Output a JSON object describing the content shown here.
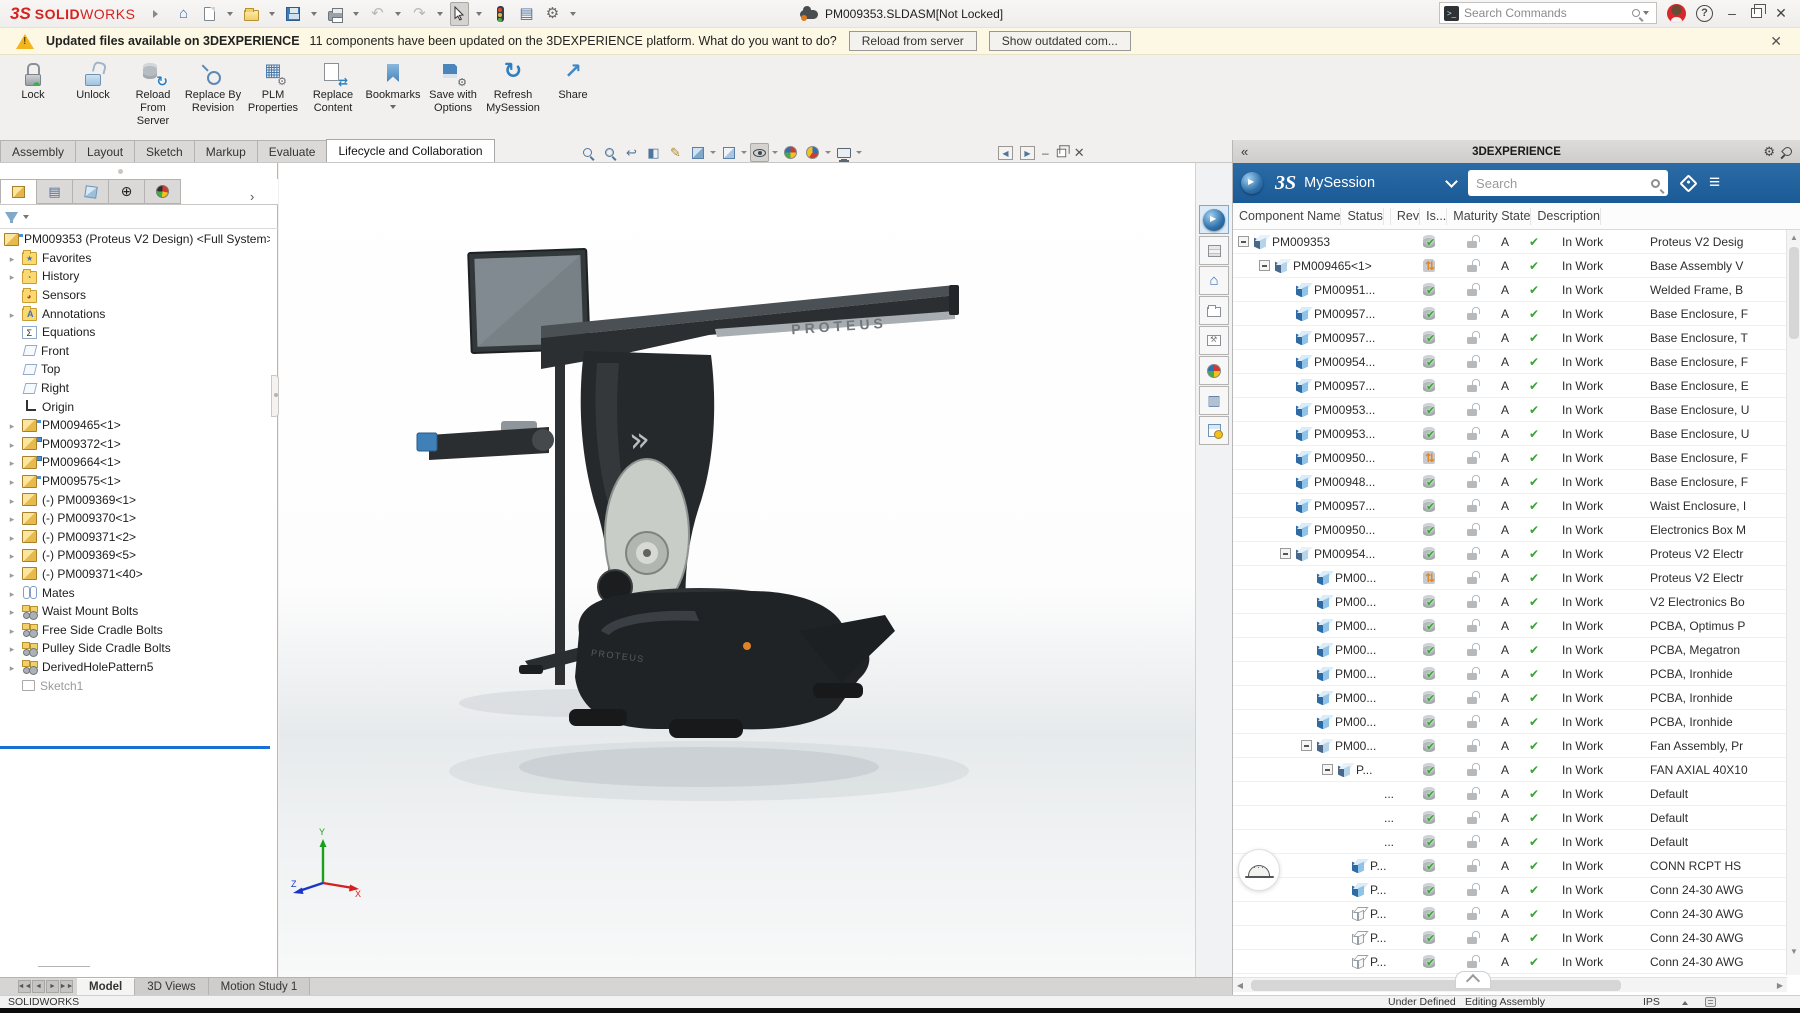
{
  "titlebar": {
    "logo_mark": "3S",
    "logo_bold": "SOLID",
    "logo_light": "WORKS",
    "doc_title": "PM009353.SLDASM[Not Locked]",
    "search_placeholder": "Search Commands"
  },
  "notification": {
    "title": "Updated files available on 3DEXPERIENCE",
    "message": "11 components have been updated on the 3DEXPERIENCE platform. What do you want to do?",
    "reload_button": "Reload from server",
    "outdated_button": "Show outdated com..."
  },
  "ribbon": {
    "buttons": [
      {
        "label": "Lock",
        "icon": "lock"
      },
      {
        "label": "Unlock",
        "icon": "unlock"
      },
      {
        "label": "Reload From Server",
        "icon": "reload-server"
      },
      {
        "label": "Replace By Revision",
        "icon": "replace-revision"
      },
      {
        "label": "PLM Properties",
        "icon": "plm-properties"
      },
      {
        "label": "Replace Content",
        "icon": "replace-content"
      },
      {
        "label": "Bookmarks",
        "icon": "bookmarks",
        "caret": true
      },
      {
        "label": "Save with Options",
        "icon": "save-options"
      },
      {
        "label": "Refresh MySession",
        "icon": "refresh-mysession"
      },
      {
        "label": "Share",
        "icon": "share"
      }
    ]
  },
  "command_tabs": {
    "items": [
      {
        "label": "Assembly"
      },
      {
        "label": "Layout"
      },
      {
        "label": "Sketch"
      },
      {
        "label": "Markup"
      },
      {
        "label": "Evaluate"
      },
      {
        "label": "Lifecycle and Collaboration",
        "active": true
      }
    ]
  },
  "feature_tree": {
    "items": [
      {
        "label": "PM009353 (Proteus V2 Design) <Full System>",
        "icon": "root",
        "root": true
      },
      {
        "label": "Favorites",
        "icon": "folder-star",
        "caret": true
      },
      {
        "label": "History",
        "icon": "folder-clock",
        "caret": true
      },
      {
        "label": "Sensors",
        "icon": "folder-gauge"
      },
      {
        "label": "Annotations",
        "icon": "folder-a",
        "caret": true
      },
      {
        "label": "Equations",
        "icon": "sigma"
      },
      {
        "label": "Front",
        "icon": "plane"
      },
      {
        "label": "Top",
        "icon": "plane"
      },
      {
        "label": "Right",
        "icon": "plane"
      },
      {
        "label": "Origin",
        "icon": "origin"
      },
      {
        "label": "PM009465<1>",
        "icon": "asm",
        "caret": true
      },
      {
        "label": "PM009372<1>",
        "icon": "part2",
        "caret": true
      },
      {
        "label": "PM009664<1>",
        "icon": "part2",
        "caret": true
      },
      {
        "label": "PM009575<1>",
        "icon": "asm",
        "caret": true
      },
      {
        "label": "(-) PM009369<1>",
        "icon": "part",
        "caret": true
      },
      {
        "label": "(-) PM009370<1>",
        "icon": "part",
        "caret": true
      },
      {
        "label": "(-) PM009371<2>",
        "icon": "part",
        "caret": true
      },
      {
        "label": "(-) PM009369<5>",
        "icon": "part",
        "caret": true
      },
      {
        "label": "(-) PM009371<40>",
        "icon": "part",
        "caret": true
      },
      {
        "label": "Mates",
        "icon": "clip",
        "caret": true
      },
      {
        "label": "Waist Mount Bolts",
        "icon": "pattern",
        "caret": true
      },
      {
        "label": "Free Side Cradle Bolts",
        "icon": "pattern",
        "caret": true
      },
      {
        "label": "Pulley Side Cradle Bolts",
        "icon": "pattern",
        "caret": true
      },
      {
        "label": "DerivedHolePattern5",
        "icon": "pattern",
        "caret": true
      },
      {
        "label": "Sketch1",
        "icon": "sketch",
        "dim": true
      }
    ]
  },
  "session_panel": {
    "title": "3DEXPERIENCE",
    "logo_mark": "3S",
    "app_name": "MySession",
    "search_placeholder": "Search",
    "columns": [
      {
        "label": "Component Name"
      },
      {
        "label": "Status"
      },
      {
        "label": ""
      },
      {
        "label": "Rev"
      },
      {
        "label": "Is..."
      },
      {
        "label": "Maturity State"
      },
      {
        "label": "Description"
      }
    ],
    "rows": [
      {
        "name": "PM009353",
        "depth": 0,
        "icon": "asm",
        "expand": true,
        "status": "check",
        "rev": "A",
        "maturity": "In Work",
        "desc": "Proteus V2 Desig"
      },
      {
        "name": "PM009465<1>",
        "depth": 1,
        "icon": "asm",
        "expand": true,
        "status": "sync",
        "rev": "A",
        "maturity": "In Work",
        "desc": "Base Assembly V"
      },
      {
        "name": "PM00951...",
        "depth": 2,
        "icon": "part",
        "status": "check",
        "rev": "A",
        "maturity": "In Work",
        "desc": "Welded Frame, B"
      },
      {
        "name": "PM00957...",
        "depth": 2,
        "icon": "part",
        "status": "check",
        "rev": "A",
        "maturity": "In Work",
        "desc": "Base Enclosure, F"
      },
      {
        "name": "PM00957...",
        "depth": 2,
        "icon": "part",
        "status": "check",
        "rev": "A",
        "maturity": "In Work",
        "desc": "Base Enclosure, T"
      },
      {
        "name": "PM00954...",
        "depth": 2,
        "icon": "part",
        "status": "check",
        "rev": "A",
        "maturity": "In Work",
        "desc": "Base Enclosure, F"
      },
      {
        "name": "PM00957...",
        "depth": 2,
        "icon": "part",
        "status": "check",
        "rev": "A",
        "maturity": "In Work",
        "desc": "Base Enclosure, E"
      },
      {
        "name": "PM00953...",
        "depth": 2,
        "icon": "part",
        "status": "check",
        "rev": "A",
        "maturity": "In Work",
        "desc": "Base Enclosure, U"
      },
      {
        "name": "PM00953...",
        "depth": 2,
        "icon": "part",
        "status": "check",
        "rev": "A",
        "maturity": "In Work",
        "desc": "Base Enclosure, U"
      },
      {
        "name": "PM00950...",
        "depth": 2,
        "icon": "part",
        "status": "sync",
        "rev": "A",
        "maturity": "In Work",
        "desc": "Base Enclosure, F"
      },
      {
        "name": "PM00948...",
        "depth": 2,
        "icon": "part",
        "status": "check",
        "rev": "A",
        "maturity": "In Work",
        "desc": "Base Enclosure, F"
      },
      {
        "name": "PM00957...",
        "depth": 2,
        "icon": "part",
        "status": "check",
        "rev": "A",
        "maturity": "In Work",
        "desc": "Waist Enclosure, I"
      },
      {
        "name": "PM00950...",
        "depth": 2,
        "icon": "part",
        "status": "check",
        "rev": "A",
        "maturity": "In Work",
        "desc": "Electronics Box M"
      },
      {
        "name": "PM00954...",
        "depth": 2,
        "icon": "asm",
        "expand": true,
        "status": "check",
        "rev": "A",
        "maturity": "In Work",
        "desc": "Proteus V2 Electr"
      },
      {
        "name": "PM00...",
        "depth": 3,
        "icon": "part",
        "status": "sync",
        "rev": "A",
        "maturity": "In Work",
        "desc": "Proteus V2 Electr"
      },
      {
        "name": "PM00...",
        "depth": 3,
        "icon": "part",
        "status": "check",
        "rev": "A",
        "maturity": "In Work",
        "desc": "V2 Electronics Bo"
      },
      {
        "name": "PM00...",
        "depth": 3,
        "icon": "part",
        "status": "check",
        "rev": "A",
        "maturity": "In Work",
        "desc": "PCBA, Optimus P"
      },
      {
        "name": "PM00...",
        "depth": 3,
        "icon": "part",
        "status": "check",
        "rev": "A",
        "maturity": "In Work",
        "desc": "PCBA, Megatron"
      },
      {
        "name": "PM00...",
        "depth": 3,
        "icon": "part",
        "status": "check",
        "rev": "A",
        "maturity": "In Work",
        "desc": "PCBA, Ironhide"
      },
      {
        "name": "PM00...",
        "depth": 3,
        "icon": "part",
        "status": "check",
        "rev": "A",
        "maturity": "In Work",
        "desc": "PCBA, Ironhide"
      },
      {
        "name": "PM00...",
        "depth": 3,
        "icon": "part",
        "status": "check",
        "rev": "A",
        "maturity": "In Work",
        "desc": "PCBA, Ironhide"
      },
      {
        "name": "PM00...",
        "depth": 3,
        "icon": "asm",
        "expand": true,
        "status": "check",
        "rev": "A",
        "maturity": "In Work",
        "desc": "Fan Assembly, Pr"
      },
      {
        "name": "P...",
        "depth": 4,
        "icon": "asm",
        "expand": true,
        "status": "check",
        "rev": "A",
        "maturity": "In Work",
        "desc": "FAN AXIAL 40X10"
      },
      {
        "name": "...",
        "depth": 6,
        "icon": "none",
        "status": "check",
        "rev": "A",
        "maturity": "In Work",
        "desc": "Default"
      },
      {
        "name": "...",
        "depth": 6,
        "icon": "none",
        "status": "check",
        "rev": "A",
        "maturity": "In Work",
        "desc": "Default"
      },
      {
        "name": "...",
        "depth": 6,
        "icon": "none",
        "status": "check",
        "rev": "A",
        "maturity": "In Work",
        "desc": "Default"
      },
      {
        "name": "P...",
        "depth": 5,
        "icon": "part",
        "status": "check",
        "rev": "A",
        "maturity": "In Work",
        "desc": "CONN RCPT HS"
      },
      {
        "name": "P...",
        "depth": 5,
        "icon": "part",
        "status": "check",
        "rev": "A",
        "maturity": "In Work",
        "desc": "Conn 24-30 AWG"
      },
      {
        "name": "P...",
        "depth": 5,
        "icon": "part-o",
        "status": "check",
        "rev": "A",
        "maturity": "In Work",
        "desc": "Conn 24-30 AWG"
      },
      {
        "name": "P...",
        "depth": 5,
        "icon": "part-o",
        "status": "check",
        "rev": "A",
        "maturity": "In Work",
        "desc": "Conn 24-30 AWG"
      },
      {
        "name": "P...",
        "depth": 5,
        "icon": "part-o",
        "status": "check",
        "rev": "A",
        "maturity": "In Work",
        "desc": "Conn 24-30 AWG"
      }
    ]
  },
  "bottom_tabs": {
    "items": [
      {
        "label": "Model",
        "active": true
      },
      {
        "label": "3D Views"
      },
      {
        "label": "Motion Study 1"
      }
    ]
  },
  "statusbar": {
    "app": "SOLIDWORKS",
    "state": "Under Defined",
    "mode": "Editing Assembly",
    "units": "IPS"
  },
  "model": {
    "arm_brand": "PROTEUS",
    "base_brand": "PROTEUS"
  },
  "triad": {
    "x": "X",
    "y": "Y",
    "z": "Z"
  },
  "icons": {
    "collapse_panel": "«",
    "menu": "≡"
  }
}
